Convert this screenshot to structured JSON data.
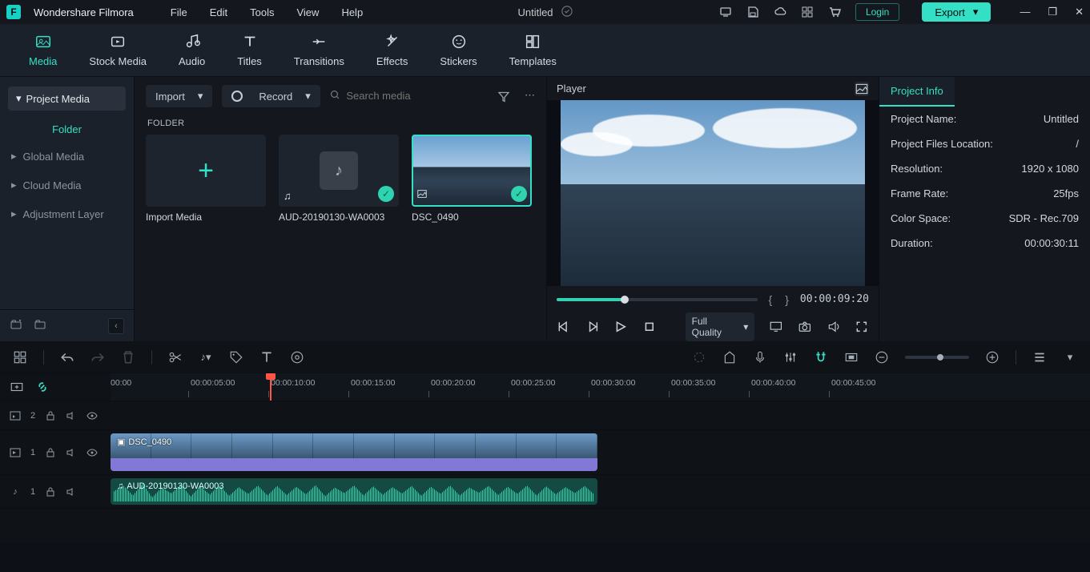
{
  "app": {
    "name": "Wondershare Filmora",
    "doc": "Untitled"
  },
  "menu": {
    "file": "File",
    "edit": "Edit",
    "tools": "Tools",
    "view": "View",
    "help": "Help"
  },
  "topright": {
    "login": "Login",
    "export": "Export"
  },
  "ribbon": {
    "media": "Media",
    "stock": "Stock Media",
    "audio": "Audio",
    "titles": "Titles",
    "transitions": "Transitions",
    "effects": "Effects",
    "stickers": "Stickers",
    "templates": "Templates"
  },
  "sidebar": {
    "project": "Project Media",
    "folder": "Folder",
    "global": "Global Media",
    "cloud": "Cloud Media",
    "adjust": "Adjustment Layer"
  },
  "browser": {
    "import": "Import",
    "record": "Record",
    "search_ph": "Search media",
    "folder_head": "FOLDER",
    "items": {
      "add": "Import Media",
      "aud": "AUD-20190130-WA0003",
      "img": "DSC_0490"
    }
  },
  "player": {
    "title": "Player",
    "mark_in": "{",
    "mark_out": "}",
    "tc": "00:00:09:20",
    "quality": "Full Quality"
  },
  "props": {
    "tab": "Project Info",
    "rows": {
      "name_l": "Project Name:",
      "name_v": "Untitled",
      "loc_l": "Project Files Location:",
      "loc_v": "/",
      "res_l": "Resolution:",
      "res_v": "1920 x 1080",
      "fr_l": "Frame Rate:",
      "fr_v": "25fps",
      "cs_l": "Color Space:",
      "cs_v": "SDR - Rec.709",
      "dur_l": "Duration:",
      "dur_v": "00:00:30:11"
    }
  },
  "timeline": {
    "ticks": [
      "00:00",
      "00:00:05:00",
      "00:00:10:00",
      "00:00:15:00",
      "00:00:20:00",
      "00:00:25:00",
      "00:00:30:00",
      "00:00:35:00",
      "00:00:40:00",
      "00:00:45:00"
    ],
    "tracks": {
      "fx_num": "2",
      "v_num": "1",
      "a_num": "1",
      "v_clip": "DSC_0490",
      "a_clip": "AUD-20190130-WA0003"
    }
  }
}
